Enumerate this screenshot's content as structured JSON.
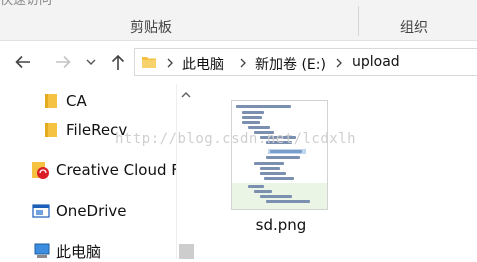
{
  "ribbon": {
    "clipped_text": "快速访问",
    "group_clipboard": "剪贴板",
    "group_organize": "组织"
  },
  "nav": {
    "back_icon": "arrow-left-icon",
    "forward_icon": "arrow-right-icon",
    "recent_icon": "chevron-down-icon",
    "up_icon": "arrow-up-icon"
  },
  "address": {
    "crumbs": [
      "此电脑",
      "新加卷 (E:)",
      "upload"
    ]
  },
  "tree": {
    "items": [
      {
        "label": "CA",
        "icon": "folder-icon"
      },
      {
        "label": "FileRecv",
        "icon": "folder-icon"
      },
      {
        "label": "Creative Cloud F",
        "icon": "creative-cloud-icon"
      },
      {
        "label": "OneDrive",
        "icon": "onedrive-icon"
      },
      {
        "label": "此电脑",
        "icon": "computer-icon"
      }
    ]
  },
  "files": [
    {
      "name": "sd.png",
      "type": "image-thumbnail"
    }
  ],
  "watermark": "http://blog.csdn.net/lcdxlh",
  "colors": {
    "folder": "#f5c242",
    "accent": "#0078d7",
    "ribbon_bg": "#f3f3f3"
  }
}
